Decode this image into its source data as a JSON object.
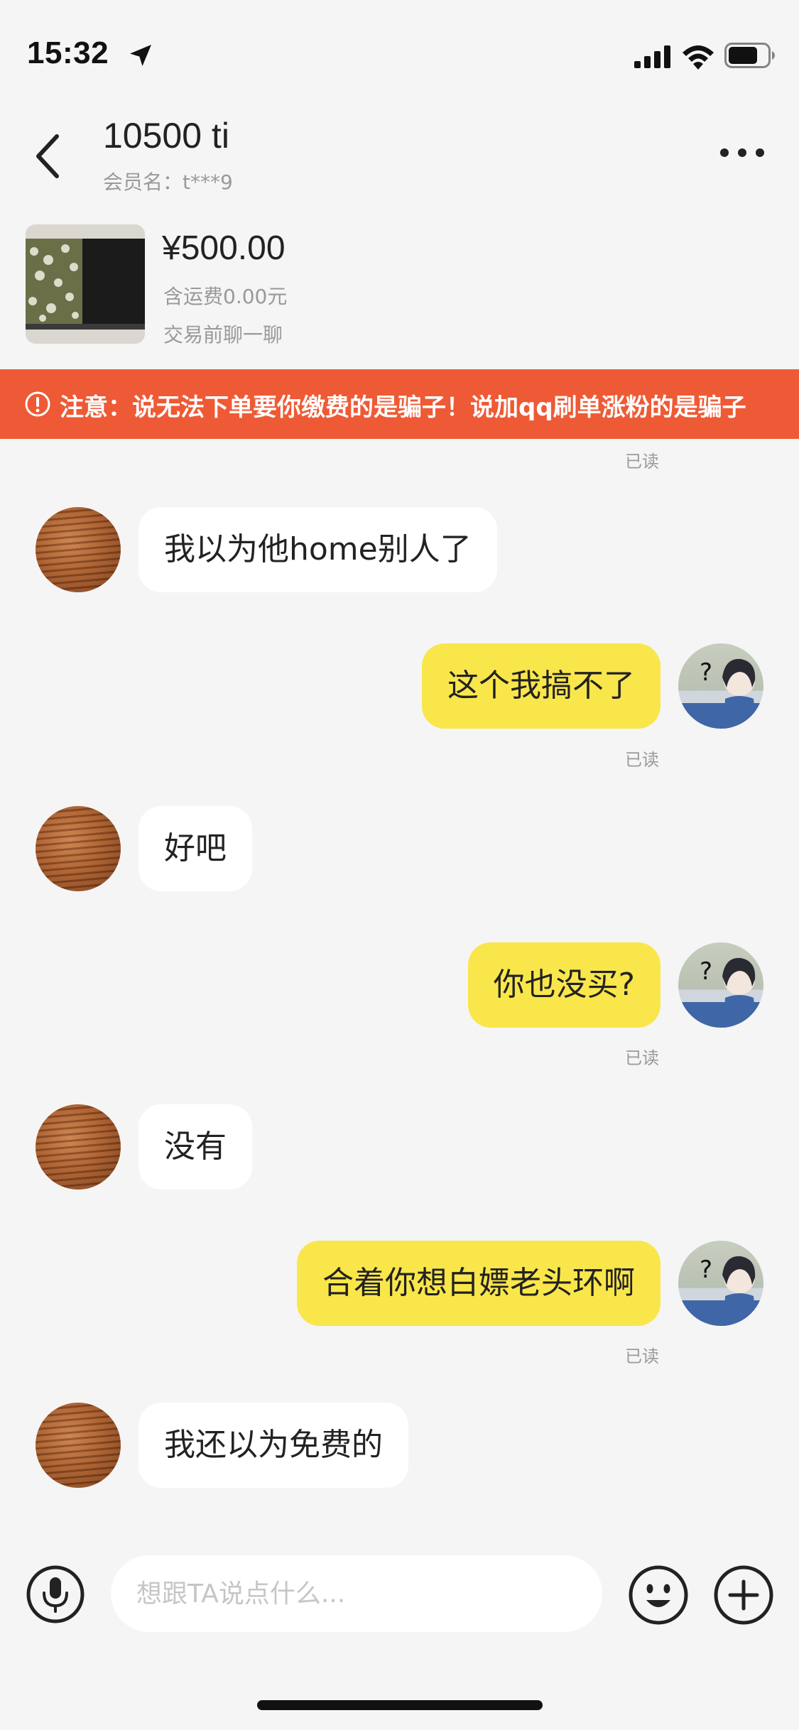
{
  "status_bar": {
    "time": "15:32",
    "icons": [
      "location-arrow-icon",
      "cellular-signal-icon",
      "wifi-icon",
      "battery-icon"
    ]
  },
  "header": {
    "title": "10500 ti",
    "member_label": "会员名：t***9",
    "icons": [
      "back-chevron-icon",
      "more-dots-icon"
    ]
  },
  "product": {
    "price": "¥500.00",
    "shipping": "含运费0.00元",
    "note": "交易前聊一聊"
  },
  "warning": {
    "text": "注意：说无法下单要你缴费的是骗子！说加qq刷单涨粉的是骗子",
    "color": "#ee5a35",
    "icon": "exclamation-circle-icon"
  },
  "messages": {
    "read_label": "已读",
    "items": [
      {
        "side": "left",
        "text": "我以为他home别人了"
      },
      {
        "side": "right",
        "text": "这个我搞不了"
      },
      {
        "side": "left",
        "text": "好吧"
      },
      {
        "side": "right",
        "text": "你也没买?"
      },
      {
        "side": "left",
        "text": "没有"
      },
      {
        "side": "right",
        "text": "合着你想白嫖老头环啊"
      },
      {
        "side": "left",
        "text": "我还以为免费的"
      }
    ]
  },
  "input_bar": {
    "placeholder": "想跟TA说点什么...",
    "icons": [
      "microphone-icon",
      "emoji-icon",
      "plus-icon"
    ]
  },
  "colors": {
    "background": "#f5f5f5",
    "my_bubble": "#f9e64b",
    "other_bubble": "#ffffff",
    "banner": "#ee5a35"
  }
}
